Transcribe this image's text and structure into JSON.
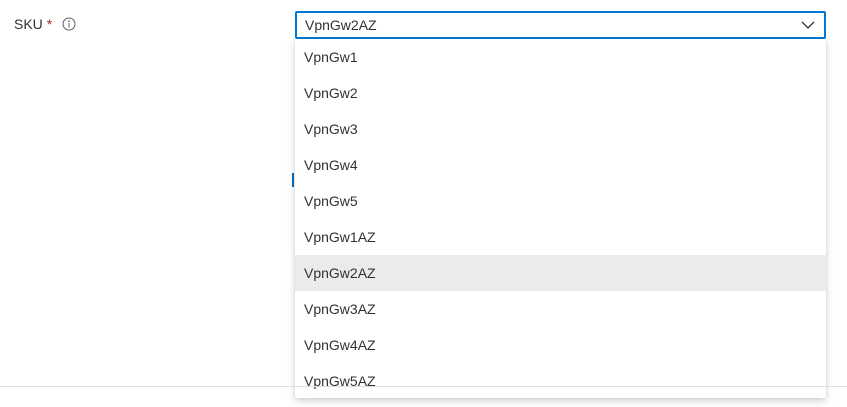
{
  "field": {
    "label": "SKU",
    "required_marker": "*",
    "info_icon": "info-icon"
  },
  "dropdown": {
    "selected_value": "VpnGw2AZ",
    "chevron_icon": "chevron-down-icon",
    "accent_color": "#0078d4",
    "options": [
      {
        "label": "VpnGw1"
      },
      {
        "label": "VpnGw2"
      },
      {
        "label": "VpnGw3"
      },
      {
        "label": "VpnGw4"
      },
      {
        "label": "VpnGw5"
      },
      {
        "label": "VpnGw1AZ"
      },
      {
        "label": "VpnGw2AZ"
      },
      {
        "label": "VpnGw3AZ"
      },
      {
        "label": "VpnGw4AZ"
      },
      {
        "label": "VpnGw5AZ"
      }
    ],
    "highlighted_option": "VpnGw2AZ",
    "highlight_color": "#edebe9"
  }
}
